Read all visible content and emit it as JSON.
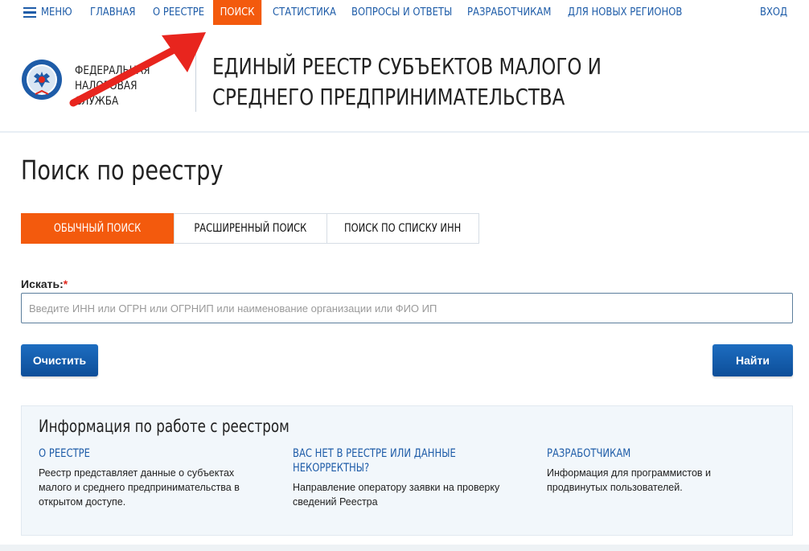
{
  "nav": {
    "menu_label": "МЕНЮ",
    "items": [
      "ГЛАВНАЯ",
      "О РЕЕСТРЕ",
      "ПОИСК",
      "СТАТИСТИКА",
      "ВОПРОСЫ И ОТВЕТЫ",
      "РАЗРАБОТЧИКАМ",
      "ДЛЯ НОВЫХ РЕГИОНОВ"
    ],
    "active": "ПОИСК",
    "login": "ВХОД"
  },
  "header": {
    "agency_line1": "ФЕДЕРАЛЬНАЯ",
    "agency_line2": "НАЛОГОВАЯ СЛУЖБА",
    "registry_title": "ЕДИНЫЙ РЕЕСТР СУБЪЕКТОВ МАЛОГО И СРЕДНЕГО ПРЕДПРИНИМАТЕЛЬСТВА"
  },
  "page": {
    "title": "Поиск по реестру"
  },
  "tabs": [
    "ОБЫЧНЫЙ ПОИСК",
    "РАСШИРЕННЫЙ ПОИСК",
    "ПОИСК ПО СПИСКУ ИНН"
  ],
  "search": {
    "label": "Искать:",
    "required_mark": "*",
    "value": "",
    "placeholder": "Введите ИНН или ОГРН или ОГРНИП или наименование организации или ФИО ИП"
  },
  "buttons": {
    "clear": "Очистить",
    "find": "Найти"
  },
  "info": {
    "title": "Информация по работе с реестром",
    "columns": [
      {
        "title": "О РЕЕСТРЕ",
        "text": "Реестр представляет данные о субъектах малого и среднего предпринимательства в открытом доступе."
      },
      {
        "title": "ВАС НЕТ В РЕЕСТРЕ ИЛИ ДАННЫЕ НЕКОРРЕКТНЫ?",
        "text": "Направление оператору заявки на проверку сведений Реестра"
      },
      {
        "title": "РАЗРАБОТЧИКАМ",
        "text": "Информация для программистов и продвинутых пользователей."
      }
    ]
  },
  "colors": {
    "accent": "#f35a0d",
    "link": "#1e5ca8",
    "button": "#0f5aa8",
    "annotation_arrow": "#e8251e"
  },
  "icons": {
    "menu": "hamburger-icon",
    "emblem": "fns-emblem-icon",
    "annotation": "red-arrow-annotation"
  }
}
